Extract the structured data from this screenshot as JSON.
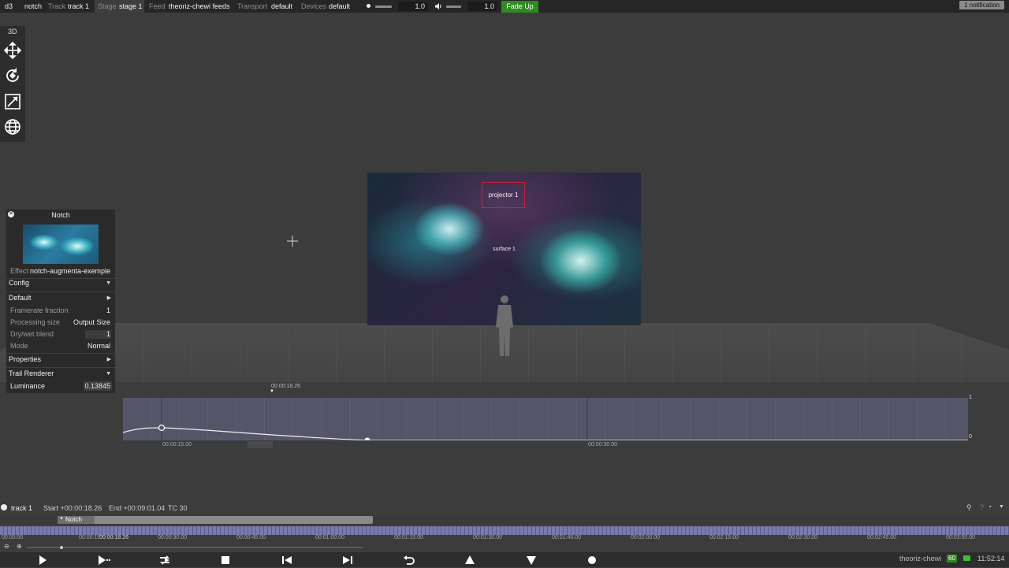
{
  "topbar": {
    "app": "d3",
    "project": "notch",
    "track_label": "Track",
    "track_value": "track 1",
    "stage_label": "Stage",
    "stage_value": "stage 1",
    "feed_label": "Feed",
    "feed_value": "theoriz-chewi feeds",
    "transport_label": "Transport",
    "transport_value": "default",
    "devices_label": "Devices",
    "devices_value": "default",
    "brightness_value": "1.0",
    "volume_value": "1.0",
    "fade_button": "Fade Up",
    "notifications": "1 notification"
  },
  "tools": {
    "mode_label": "3D",
    "items": [
      "move-icon",
      "rotate-icon",
      "scale-icon",
      "globe-icon"
    ]
  },
  "viewport": {
    "projector_label": "projector 1",
    "surface_label": "surface 1"
  },
  "layer_panel": {
    "title": "Notch",
    "effect_label": "Effect",
    "effect_value": "notch-augmenta-exemple",
    "config_label": "Config",
    "default_label": "Default",
    "framerate_label": "Framerate fraction",
    "framerate_value": "1",
    "processing_label": "Processing size",
    "processing_value": "Output Size",
    "drywet_label": "Dry/wet blend",
    "drywet_value": "1",
    "mode_label": "Mode",
    "mode_value": "Normal",
    "properties_label": "Properties",
    "trail_label": "Trail Renderer",
    "luminance_label": "Luminance",
    "luminance_value": "0.13845"
  },
  "curve_editor": {
    "playhead_time": "00:00:18.26",
    "mark_1": "00:00:15.00",
    "mark_2": "00:00:30.00",
    "ymax": "1",
    "ymin": "0"
  },
  "timeline": {
    "track_name": "track 1",
    "start": "Start +00:00:18.26",
    "end": "End +00:09:01.04",
    "tc": "TC 30",
    "layer_name": "Notch",
    "current_time": "00:00:18.26",
    "ruler_labels": [
      "00:00:00",
      "00:00:15.00",
      "00:00:30.00",
      "00:00:45.00",
      "00:01:00.00",
      "00:01:15.00",
      "00:01:30.00",
      "00:01:45.00",
      "00:02:00.00",
      "00:02:15.00",
      "00:02:30.00",
      "00:02:45.00",
      "00:03:00.00"
    ]
  },
  "status": {
    "machine": "theoriz-chewi",
    "fps": "60",
    "clock": "11:52:14"
  },
  "colors": {
    "accent_green": "#2e8b1f",
    "projector_red": "#b82a3a",
    "ruler_purple": "#7c7aa8"
  }
}
